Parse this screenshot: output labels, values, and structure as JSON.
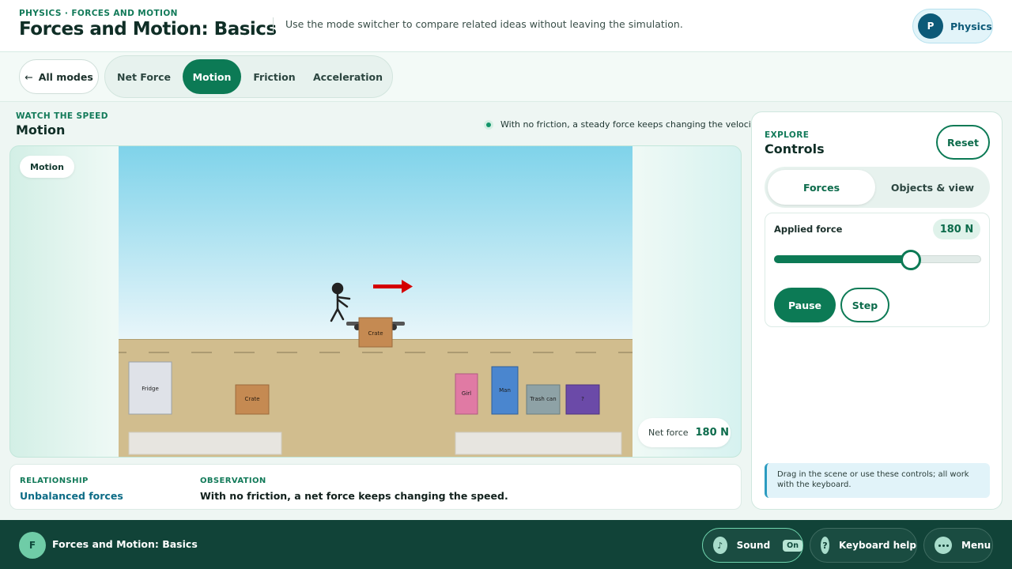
{
  "header": {
    "eyebrow": "PHYSICS · FORCES AND MOTION",
    "title": "Forces and Motion: Basics",
    "subtitle": "Use the mode switcher to compare related ideas without leaving the simulation.",
    "subject": {
      "initial": "P",
      "label": "Physics"
    }
  },
  "modebar": {
    "all_modes": "All modes",
    "tabs": [
      {
        "label": "Net Force",
        "active": false
      },
      {
        "label": "Motion",
        "active": true
      },
      {
        "label": "Friction",
        "active": false
      },
      {
        "label": "Acceleration",
        "active": false
      }
    ]
  },
  "scene": {
    "eyebrow": "WATCH THE SPEED",
    "title": "Motion",
    "note": "With no friction, a steady force keeps changing the velocity.",
    "badge": "Motion",
    "objects": {
      "active": "Crate",
      "fridge": "Fridge",
      "crate": "Crate",
      "girl": "Girl",
      "man": "Man",
      "trash": "Trash can",
      "mystery": "?"
    },
    "net_force_label": "Net force",
    "net_force_value": "180 N"
  },
  "observation": {
    "relationship_heading": "RELATIONSHIP",
    "relationship_value": "Unbalanced forces",
    "observation_heading": "OBSERVATION",
    "observation_value": "With no friction, a net force keeps changing the speed."
  },
  "controls": {
    "eyebrow": "EXPLORE",
    "title": "Controls",
    "reset": "Reset",
    "tabs": [
      {
        "label": "Forces",
        "active": true
      },
      {
        "label": "Objects & view",
        "active": false
      }
    ],
    "applied_force_label": "Applied force",
    "applied_force_value": "180 N",
    "applied_force_fraction": 0.66,
    "pause": "Pause",
    "step": "Step",
    "hint": "Drag in the scene or use these controls; all work with the keyboard."
  },
  "footer": {
    "initial": "F",
    "title": "Forces and Motion: Basics",
    "sound": "Sound",
    "sound_state": "On",
    "sound_icon": "♪",
    "keyboard": "Keyboard help",
    "keyboard_icon": "?",
    "menu": "Menu"
  },
  "colors": {
    "brand": "#0c7a55",
    "footer_bg": "#114338",
    "sky_top": "#7fd3ea",
    "ground": "#d1bd8e",
    "force_arrow": "#d40000"
  }
}
